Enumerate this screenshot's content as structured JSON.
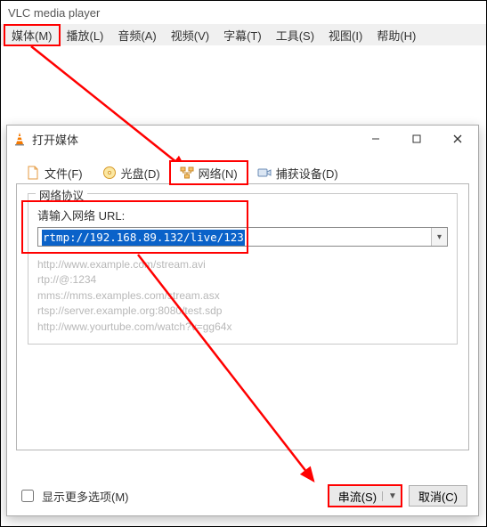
{
  "app_title": "VLC media player",
  "menubar": {
    "media": "媒体(M)",
    "playback": "播放(L)",
    "audio": "音频(A)",
    "video": "视频(V)",
    "subtitle": "字幕(T)",
    "tools": "工具(S)",
    "view": "视图(I)",
    "help": "帮助(H)"
  },
  "dialog": {
    "title": "打开媒体",
    "tabs": {
      "file": "文件(F)",
      "disc": "光盘(D)",
      "network": "网络(N)",
      "capture": "捕获设备(D)"
    },
    "network": {
      "group_title": "网络协议",
      "url_label": "请输入网络 URL:",
      "url_value": "rtmp://192.168.89.132/live/123",
      "examples": {
        "l1": "http://www.example.com/stream.avi",
        "l2": "rtp://@:1234",
        "l3": "mms://mms.examples.com/stream.asx",
        "l4": "rtsp://server.example.org:8080/test.sdp",
        "l5": "http://www.yourtube.com/watch?v=gg64x"
      }
    },
    "more_options": "显示更多选项(M)",
    "stream_btn": "串流(S)",
    "cancel_btn": "取消(C)"
  }
}
